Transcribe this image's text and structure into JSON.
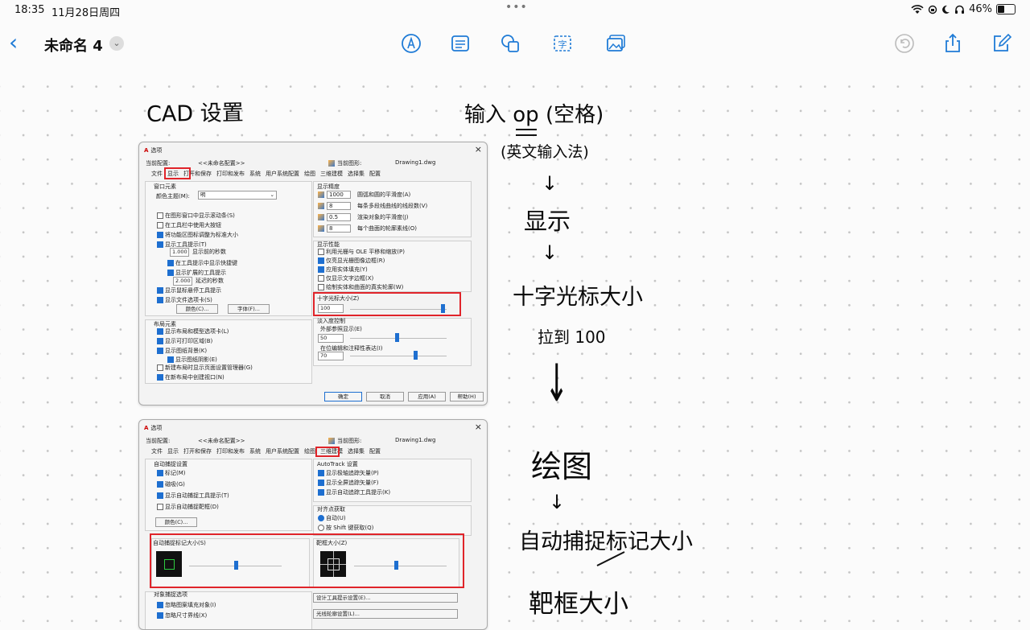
{
  "status_bar": {
    "time": "18:35",
    "date": "11月28日周四",
    "battery": "46%",
    "battery_level": 0.46,
    "dots": "•••"
  },
  "toolbar": {
    "back_glyph": "‹",
    "title": "未命名 4",
    "title_chevron": "⌄"
  },
  "notes": {
    "cad_title": "CAD 设置",
    "step1": "输入 op (空格)",
    "step1_sub": "(英文输入法)",
    "arrow": "↓",
    "display": "显示",
    "crosshair": "十字光标大小",
    "drag": "拉到 100",
    "drawing": "绘图",
    "autosnap": "自动捕捉标记大小",
    "aperture": "靶框大小"
  },
  "dialog1": {
    "title": "选项",
    "close": "×",
    "profile_label": "当前配置:",
    "profile_value": "<<未命名配置>>",
    "drawing_label": "当前图形:",
    "drawing_value": "Drawing1.dwg",
    "tabs": [
      "文件",
      "显示",
      "打开和保存",
      "打印和发布",
      "系统",
      "用户系统配置",
      "绘图",
      "三维建模",
      "选择集",
      "配置"
    ],
    "window_group": "窗口元素",
    "color_scheme_label": "颜色主题(M):",
    "color_scheme_value": "明",
    "checks": [
      {
        "label": "在图形窗口中显示滚动条(S)",
        "on": false
      },
      {
        "label": "在工具栏中使用大按钮",
        "on": false
      },
      {
        "label": "将功能区图标调整为标准大小",
        "on": true
      },
      {
        "label": "显示工具提示(T)",
        "on": true
      }
    ],
    "tooltip_delay_value": "1.000",
    "tooltip_delay_label": "显示前的秒数",
    "sub_checks": [
      {
        "label": "在工具提示中显示快捷键",
        "on": true
      },
      {
        "label": "显示扩展的工具提示",
        "on": true
      }
    ],
    "ext_delay_value": "2.000",
    "ext_delay_label": "延迟的秒数",
    "checks2": [
      {
        "label": "显示鼠标悬停工具提示",
        "on": true
      },
      {
        "label": "显示文件选项卡(S)",
        "on": true
      }
    ],
    "colors_btn": "颜色(C)...",
    "fonts_btn": "字体(F)...",
    "layout_group": "布局元素",
    "layout_checks": [
      {
        "label": "显示布局和模型选项卡(L)",
        "on": true
      },
      {
        "label": "显示可打印区域(B)",
        "on": true
      },
      {
        "label": "显示图纸背景(K)",
        "on": true
      }
    ],
    "shadow_check": {
      "label": "显示图纸阴影(E)",
      "on": true
    },
    "layout_checks2": [
      {
        "label": "新建布局时显示页面设置管理器(G)",
        "on": false
      },
      {
        "label": "在新布局中创建视口(N)",
        "on": true
      }
    ],
    "resolution_group": "显示精度",
    "resolution": [
      {
        "value": "1000",
        "label": "圆弧和圆的平滑度(A)"
      },
      {
        "value": "8",
        "label": "每条多段线曲线的线段数(V)"
      },
      {
        "value": "0.5",
        "label": "渲染对象的平滑度(J)"
      },
      {
        "value": "8",
        "label": "每个曲面的轮廓素线(O)"
      }
    ],
    "performance_group": "显示性能",
    "performance": [
      {
        "label": "利用光栅与 OLE 平移和缩放(P)",
        "on": false
      },
      {
        "label": "仅亮显光栅图像边框(R)",
        "on": true
      },
      {
        "label": "应用实体填充(Y)",
        "on": true
      },
      {
        "label": "仅显示文字边框(X)",
        "on": false
      },
      {
        "label": "绘制实体和曲面的真实轮廓(W)",
        "on": false
      }
    ],
    "crosshair_label": "十字光标大小(Z)",
    "crosshair_value": "100",
    "crosshair_level": 1.0,
    "fade_group": "淡入度控制",
    "xref_label": "外部参照显示(E)",
    "xref_value": "50",
    "xref_level": 0.5,
    "inplace_label": "在位编辑和注释性表达(I)",
    "inplace_value": "70",
    "inplace_level": 0.7,
    "buttons": [
      "确定",
      "取消",
      "应用(A)",
      "帮助(H)"
    ]
  },
  "dialog2": {
    "title": "选项",
    "close": "×",
    "profile_label": "当前配置:",
    "profile_value": "<<未命名配置>>",
    "drawing_label": "当前图形:",
    "drawing_value": "Drawing1.dwg",
    "tabs": [
      "文件",
      "显示",
      "打开和保存",
      "打印和发布",
      "系统",
      "用户系统配置",
      "绘图",
      "三维建模",
      "选择集",
      "配置"
    ],
    "autosnap_group": "自动捕捉设置",
    "autosnap_checks": [
      {
        "label": "标记(M)",
        "on": true
      },
      {
        "label": "磁吸(G)",
        "on": true
      },
      {
        "label": "显示自动捕捉工具提示(T)",
        "on": true
      },
      {
        "label": "显示自动捕捉靶框(D)",
        "on": false
      }
    ],
    "colors_btn": "颜色(C)...",
    "autotrack_group": "AutoTrack 设置",
    "autotrack_checks": [
      {
        "label": "显示极轴追踪矢量(P)",
        "on": true
      },
      {
        "label": "显示全屏追踪矢量(F)",
        "on": true
      },
      {
        "label": "显示自动追踪工具提示(K)",
        "on": true
      }
    ],
    "align_group": "对齐点获取",
    "align_options": [
      {
        "label": "自动(U)",
        "on": true
      },
      {
        "label": "按 Shift 键获取(Q)",
        "on": false
      }
    ],
    "marker_size_label": "自动捕捉标记大小(S)",
    "marker_level": 0.5,
    "aperture_label": "靶框大小(Z)",
    "aperture_level": 0.45,
    "object_snap_group": "对象捕捉选项",
    "object_snap_checks": [
      {
        "label": "忽略图案填充对象(I)",
        "on": true
      },
      {
        "label": "忽略尺寸界线(X)",
        "on": true
      }
    ],
    "tooltip_btn": "设计工具提示设置(E)...",
    "lightglyph_btn": "光线轮廓设置(L)..."
  }
}
